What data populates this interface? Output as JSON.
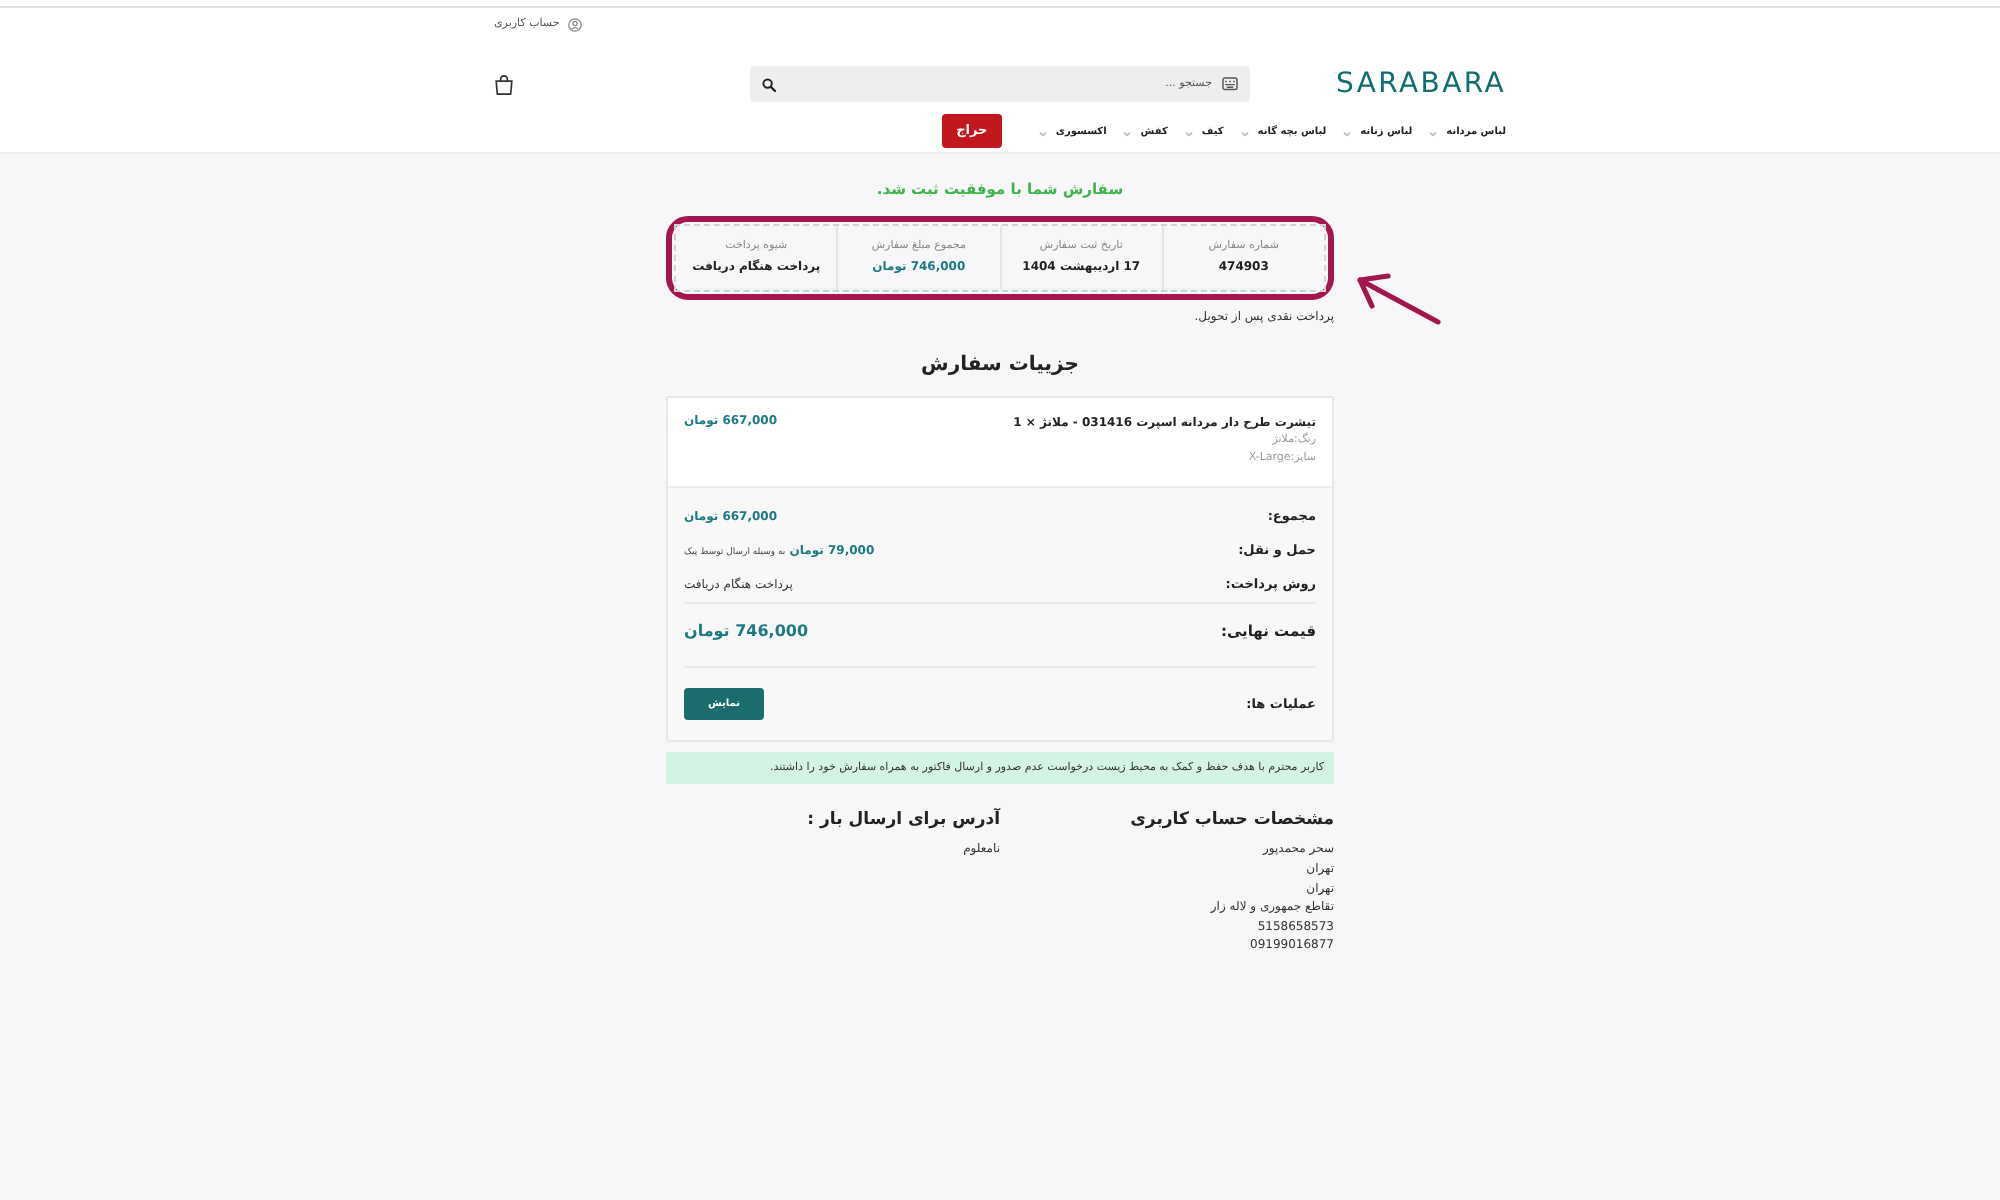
{
  "header": {
    "account_link": "حساب کاربری",
    "logo": "SARABARA",
    "search": {
      "placeholder": "جستجو ..."
    },
    "menu": [
      {
        "label": "لباس مردانه",
        "kind": "dropdown"
      },
      {
        "label": "لباس زنانه",
        "kind": "dropdown"
      },
      {
        "label": "لباس بچه گانه",
        "kind": "dropdown"
      },
      {
        "label": "کیف",
        "kind": "dropdown"
      },
      {
        "label": "کفش",
        "kind": "dropdown"
      },
      {
        "label": "اکسسوری",
        "kind": "dropdown"
      },
      {
        "label": "حراج",
        "kind": "sale"
      }
    ]
  },
  "order": {
    "success_message": "سفارش شما با موفقیت ثبت شد.",
    "summary": [
      {
        "label": "شماره سفارش",
        "value": "474903",
        "kind": "plain"
      },
      {
        "label": "تاریخ ثبت سفارش",
        "value": "17 اردیبهشت 1404",
        "kind": "plain"
      },
      {
        "label": "مجموع مبلغ سفارش",
        "value": "746,000 تومان",
        "kind": "price"
      },
      {
        "label": "شیوه پرداخت",
        "value": "پرداخت هنگام دریافت",
        "kind": "plain"
      }
    ],
    "payment_note": "پرداخت نقدی پس از تحویل."
  },
  "details": {
    "title": "جزییات سفارش",
    "items": [
      {
        "name": "تیشرت طرح دار مردانه اسپرت 031416 - ملانژ × 1",
        "attributes": [
          "رنگ:ملانژ",
          "سایز:X-Large"
        ],
        "price": "667,000 تومان"
      }
    ],
    "totals": [
      {
        "label": "مجموع:",
        "kind": "price",
        "value": "667,000 تومان"
      },
      {
        "label": "حمل و نقل:",
        "kind": "shipping",
        "value": "79,000 تومان",
        "note": "به وسیله ارسال توسط پیک"
      },
      {
        "label": "روش پرداخت:",
        "kind": "text",
        "value": "پرداخت هنگام دریافت"
      },
      {
        "label": "قیمت نهایی:",
        "kind": "total",
        "value": "746,000 تومان"
      },
      {
        "label": "عملیات ها:",
        "kind": "action",
        "value": "نمایش"
      }
    ]
  },
  "notice": "کاربر محترم با هدف حفظ و کمک به محیط زیست درخواست عدم صدور و ارسال فاکتور به همراه سفارش خود را داشتند.",
  "addresses": [
    {
      "title": "مشخصات حساب کاربری",
      "lines": [
        "سحر محمدپور",
        "تهران",
        "تهران",
        "تقاطع جمهوری و لاله زار",
        "5158658573",
        "09199016877"
      ]
    },
    {
      "title": "آدرس برای ارسال بار :",
      "lines": [
        "نامعلوم"
      ]
    }
  ]
}
